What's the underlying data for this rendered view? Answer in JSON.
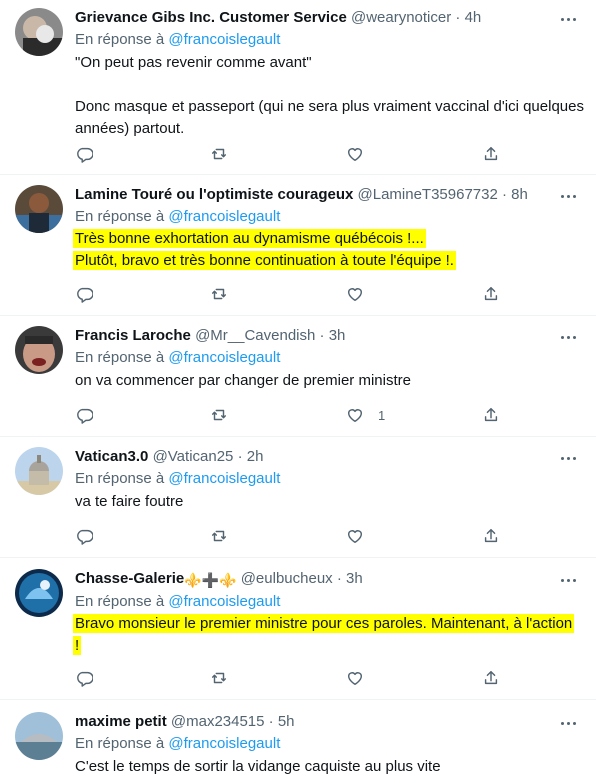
{
  "reply_prefix": "En réponse à",
  "tweets": [
    {
      "name": "Grievance Gibs Inc. Customer Service",
      "handle": "@wearynoticer",
      "time": "4h",
      "mention": "@francoislegault",
      "text": "\"On peut pas revenir comme avant\"\n\nDonc masque et passeport (qui ne sera plus vraiment vaccinal d'ici quelques années) partout.",
      "highlighted": false,
      "likes": ""
    },
    {
      "name": "Lamine Touré ou l'optimiste courageux",
      "handle": "@LamineT35967732",
      "time": "8h",
      "mention": "@francoislegault",
      "text": "Très bonne exhortation au dynamisme québécois !...\nPlutôt, bravo et très bonne continuation à toute l'équipe !.",
      "highlighted": true,
      "likes": ""
    },
    {
      "name": "Francis Laroche",
      "handle": "@Mr__Cavendish",
      "time": "3h",
      "mention": "@francoislegault",
      "text": "on va commencer par changer de premier ministre",
      "highlighted": false,
      "likes": "1"
    },
    {
      "name": "Vatican3.0",
      "handle": "@Vatican25",
      "time": "2h",
      "mention": "@francoislegault",
      "text": "va te faire foutre",
      "highlighted": false,
      "likes": ""
    },
    {
      "name": "Chasse-Galerie",
      "name_emoji": "⚜️➕⚜️",
      "handle": "@eulbucheux",
      "time": "3h",
      "mention": "@francoislegault",
      "text": "Bravo monsieur le premier ministre pour ces paroles. Maintenant, à l'action\n!",
      "highlighted": true,
      "likes": ""
    },
    {
      "name": "maxime petit",
      "handle": "@max234515",
      "time": "5h",
      "mention": "@francoislegault",
      "text": "C'est le temps de sortir la vidange caquiste au plus vite",
      "highlighted": false,
      "likes": ""
    }
  ],
  "colors": {
    "text": "#0f1419",
    "muted": "#536471",
    "link": "#1d9bf0",
    "highlight": "#ffff00",
    "divider": "#eff3f4"
  },
  "icons": [
    "reply-icon",
    "retweet-icon",
    "like-icon",
    "share-icon",
    "more-icon"
  ]
}
